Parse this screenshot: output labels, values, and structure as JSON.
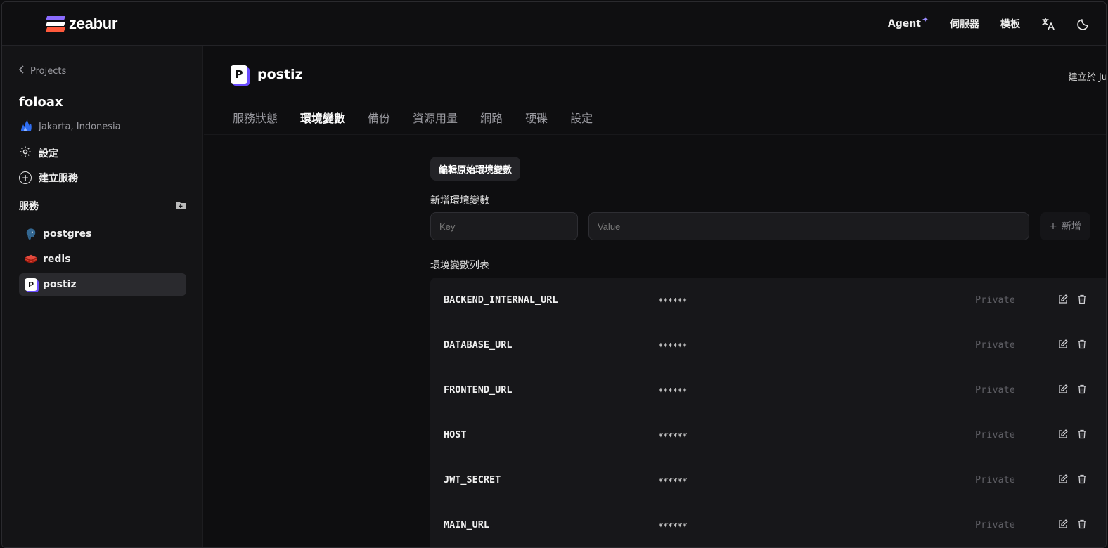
{
  "app": {
    "brand": "zeabur",
    "nav": [
      {
        "label": "Agent",
        "badge": "✦"
      },
      {
        "label": "伺服器"
      },
      {
        "label": "模板"
      }
    ]
  },
  "sidebar": {
    "back_label": "Projects",
    "project_name": "foloax",
    "region": "Jakarta, Indonesia",
    "settings_label": "設定",
    "create_service_label": "建立服務",
    "services_heading": "服務",
    "services": [
      {
        "name": "postgres",
        "icon": "postgres-icon"
      },
      {
        "name": "redis",
        "icon": "redis-icon"
      },
      {
        "name": "postiz",
        "icon": "postiz-icon",
        "active": true
      }
    ]
  },
  "main": {
    "service_title": "postiz",
    "created_text": "建立於 Ju",
    "tabs": [
      "服務狀態",
      "環境變數",
      "備份",
      "資源用量",
      "網路",
      "硬碟",
      "設定"
    ],
    "active_tab": "環境變數",
    "edit_raw_label": "編輯原始環境變數",
    "add_section_label": "新增環境變數",
    "key_placeholder": "Key",
    "value_placeholder": "Value",
    "add_button_label": "新增",
    "list_label": "環境變數列表",
    "env_vars": [
      {
        "key": "BACKEND_INTERNAL_URL",
        "value": "******",
        "visibility": "Private"
      },
      {
        "key": "DATABASE_URL",
        "value": "******",
        "visibility": "Private"
      },
      {
        "key": "FRONTEND_URL",
        "value": "******",
        "visibility": "Private"
      },
      {
        "key": "HOST",
        "value": "******",
        "visibility": "Private"
      },
      {
        "key": "JWT_SECRET",
        "value": "******",
        "visibility": "Private"
      },
      {
        "key": "MAIN_URL",
        "value": "******",
        "visibility": "Private"
      }
    ]
  },
  "colors": {
    "background": "#0e0e10",
    "sidebar": "#141416",
    "accent_purple": "#8b6cff",
    "accent_orange": "#ff5a3c"
  }
}
